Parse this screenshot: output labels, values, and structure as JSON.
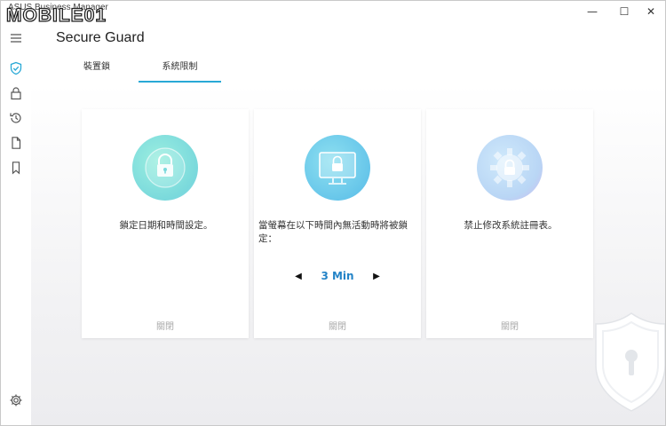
{
  "window": {
    "app_title": "ASUS Business Manager",
    "watermark": "MOBILE01",
    "controls": {
      "minimize": "—",
      "maximize": "☐",
      "close": "✕"
    }
  },
  "sidebar": {
    "items": [
      {
        "icon": "hamburger-menu-icon"
      },
      {
        "icon": "shield-check-icon",
        "active": true
      },
      {
        "icon": "lock-icon"
      },
      {
        "icon": "history-icon"
      },
      {
        "icon": "document-icon"
      },
      {
        "icon": "bookmark-icon"
      }
    ],
    "footer_icon": "gear-icon"
  },
  "header": {
    "title": "Secure Guard"
  },
  "tabs": [
    {
      "label": "裝置鎖",
      "active": false
    },
    {
      "label": "系統限制",
      "active": true
    }
  ],
  "cards": [
    {
      "illustration": "lock-clock-illustration",
      "description": "鎖定日期和時間設定。",
      "status": "關閉"
    },
    {
      "illustration": "lock-monitor-illustration",
      "description": "當螢幕在以下時間內無活動時將被鎖定：",
      "status": "關閉",
      "stepper": {
        "value": "3 Min",
        "prev": "◀",
        "next": "▶"
      }
    },
    {
      "illustration": "lock-gear-illustration",
      "description": "禁止修改系統註冊表。",
      "status": "關閉"
    }
  ],
  "colors": {
    "accent": "#29a9d6",
    "value_text": "#2383c7",
    "status_text": "#aaaaaa"
  }
}
